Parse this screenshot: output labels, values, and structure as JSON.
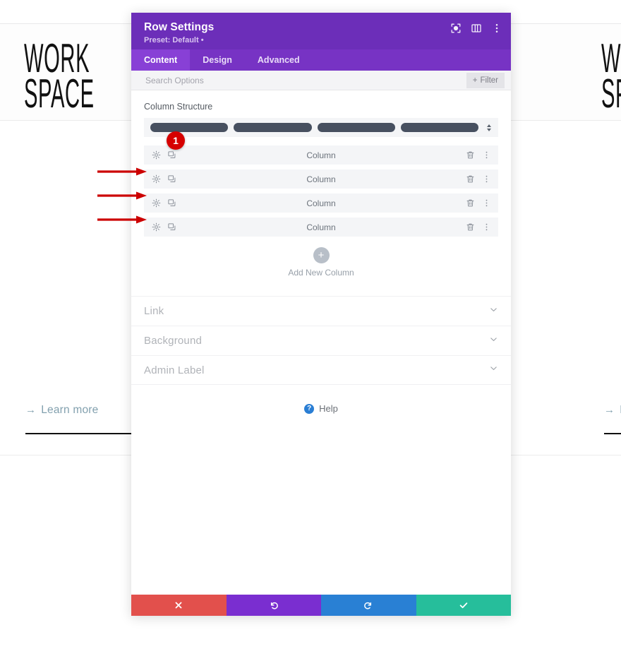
{
  "background": {
    "brand_line1": "WORK",
    "brand_line2": "SPACE",
    "brand_line1_right": "W",
    "brand_line2_right": "S",
    "learn_more": "Learn more",
    "learn_arrow": "→"
  },
  "modal": {
    "title": "Row Settings",
    "preset": "Preset: Default •",
    "header_icons": [
      {
        "name": "target-icon"
      },
      {
        "name": "panel-layout-icon"
      },
      {
        "name": "more-vertical-icon"
      }
    ],
    "tabs": [
      {
        "label": "Content",
        "active": true
      },
      {
        "label": "Design",
        "active": false
      },
      {
        "label": "Advanced",
        "active": false
      }
    ],
    "search": {
      "placeholder": "Search Options",
      "value": "",
      "filter_label": "Filter",
      "filter_plus": "+"
    },
    "column_structure": {
      "label": "Column Structure",
      "bars": 4
    },
    "columns": [
      {
        "label": "Column"
      },
      {
        "label": "Column"
      },
      {
        "label": "Column"
      },
      {
        "label": "Column"
      }
    ],
    "add_column": {
      "plus": "+",
      "label": "Add New Column"
    },
    "accordions": [
      {
        "label": "Link"
      },
      {
        "label": "Background"
      },
      {
        "label": "Admin Label"
      }
    ],
    "help": {
      "mark": "?",
      "label": "Help"
    },
    "footer_buttons": [
      {
        "name": "cancel-button",
        "icon": "close-icon",
        "color": "#E2504C"
      },
      {
        "name": "undo-button",
        "icon": "undo-icon",
        "color": "#7A2ED0"
      },
      {
        "name": "redo-button",
        "icon": "redo-icon",
        "color": "#2980D4"
      },
      {
        "name": "save-button",
        "icon": "check-icon",
        "color": "#26BE9B"
      }
    ]
  },
  "annotations": {
    "badge_number": "1",
    "arrow_color": "#CC0000",
    "arrow_count": 3
  }
}
